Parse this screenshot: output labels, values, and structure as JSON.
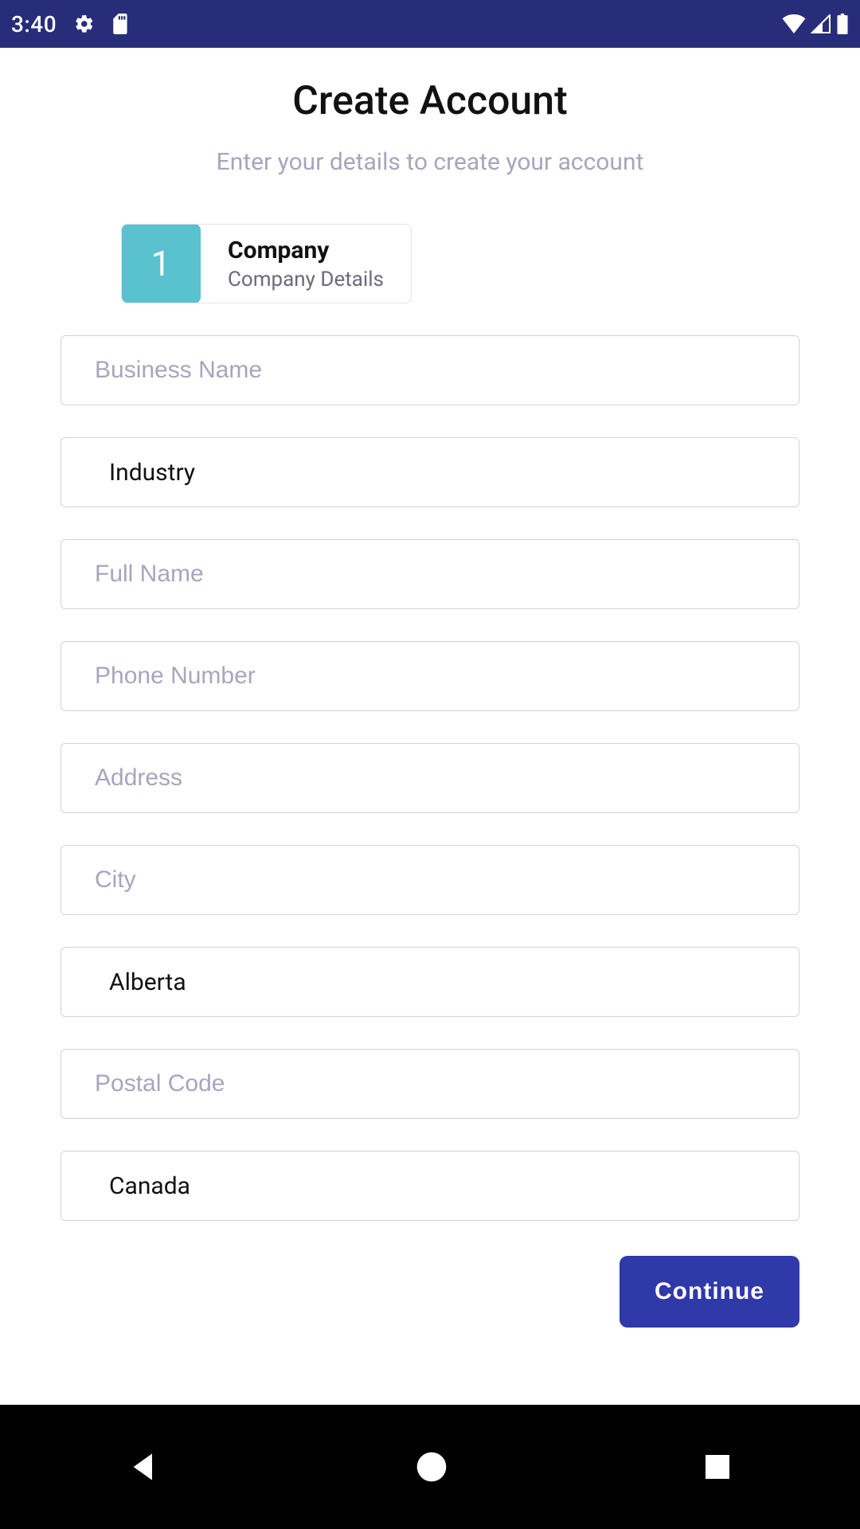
{
  "statusbar": {
    "time": "3:40"
  },
  "header": {
    "title": "Create Account",
    "subtitle": "Enter your details to create your account"
  },
  "step": {
    "number": "1",
    "title": "Company",
    "subtitle": "Company Details"
  },
  "form": {
    "business_name": {
      "placeholder": "Business Name",
      "value": ""
    },
    "industry": {
      "value": "Industry"
    },
    "full_name": {
      "placeholder": "Full Name",
      "value": ""
    },
    "phone": {
      "placeholder": "Phone Number",
      "value": ""
    },
    "address": {
      "placeholder": "Address",
      "value": ""
    },
    "city": {
      "placeholder": "City",
      "value": ""
    },
    "province": {
      "value": "Alberta"
    },
    "postal_code": {
      "placeholder": "Postal Code",
      "value": ""
    },
    "country": {
      "value": "Canada"
    }
  },
  "actions": {
    "continue": "Continue"
  }
}
